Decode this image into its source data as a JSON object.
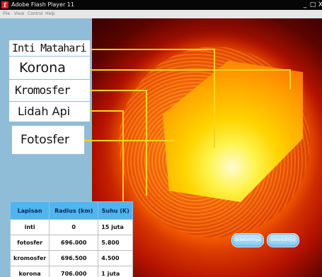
{
  "window": {
    "title": "Adobe Flash Player 11",
    "logo_glyph": "f",
    "controls": {
      "minimize": "_",
      "maximize": "□",
      "close": "X"
    }
  },
  "menu": [
    "File",
    "View",
    "Control",
    "Help"
  ],
  "labels": {
    "inti": "Inti Matahari",
    "korona": "Korona",
    "kromosfer": "Kromosfer",
    "lidah_api": "Lidah Api",
    "fotosfer": "Fotosfer"
  },
  "table": {
    "headers": [
      "Lapisan",
      "Radius (km)",
      "Suhu (K)"
    ],
    "rows": [
      [
        "inti",
        "0",
        "15 juta"
      ],
      [
        "fotosfer",
        "696.000",
        "5.800"
      ],
      [
        "kromosfer",
        "696.500",
        "4.500"
      ],
      [
        "korona",
        "706.000",
        "1 juta"
      ]
    ]
  },
  "nav": {
    "prev": "sebelumnya",
    "next": "selanjutnya"
  },
  "colors": {
    "guide_line": "#f7d320",
    "table_header": "#4fb4ef",
    "panel_bg": "#8fbdd8"
  }
}
